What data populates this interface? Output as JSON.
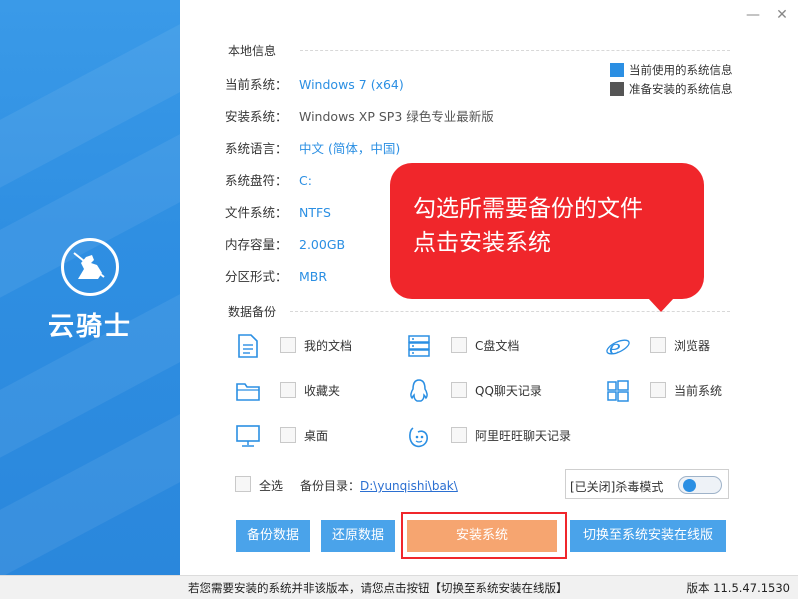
{
  "app": {
    "logo_text": "云骑士",
    "colors": {
      "accent": "#2b8fe3",
      "sidebar": "#2f8fe2",
      "tooltip": "#f0262b",
      "install": "#f6a570"
    }
  },
  "window": {
    "minimize": "—",
    "close": "✕"
  },
  "local_info": {
    "title": "本地信息",
    "rows": [
      {
        "label": "当前系统：",
        "value": "Windows 7 (x64)"
      },
      {
        "label": "安装系统：",
        "value": "Windows XP SP3 绿色专业最新版"
      },
      {
        "label": "系统语言：",
        "value": "中文 (简体，中国)"
      },
      {
        "label": "系统盘符：",
        "value": "C:"
      },
      {
        "label": "文件系统：",
        "value": "NTFS"
      },
      {
        "label": "内存容量：",
        "value": "2.00GB"
      },
      {
        "label": "分区形式：",
        "value": "MBR"
      }
    ],
    "legend": [
      {
        "label": "当前使用的系统信息",
        "color": "#2b8fe3"
      },
      {
        "label": "准备安装的系统信息",
        "color": "#555555"
      }
    ]
  },
  "tooltip": {
    "line1": "勾选所需要备份的文件",
    "line2": "点击安装系统"
  },
  "backup": {
    "title": "数据备份",
    "items": [
      {
        "label": "我的文档",
        "icon": "document-icon"
      },
      {
        "label": "C盘文档",
        "icon": "server-icon"
      },
      {
        "label": "浏览器",
        "icon": "ie-browser-icon"
      },
      {
        "label": "收藏夹",
        "icon": "folder-icon"
      },
      {
        "label": "QQ聊天记录",
        "icon": "qq-icon"
      },
      {
        "label": "当前系统",
        "icon": "windows-icon"
      },
      {
        "label": "桌面",
        "icon": "monitor-icon"
      },
      {
        "label": "阿里旺旺聊天记录",
        "icon": "wangwang-icon"
      }
    ],
    "select_all": "全选",
    "dir_label": "备份目录：",
    "dir_value": "D:\\yunqishi\\bak\\",
    "antivirus": "[已关闭]杀毒模式"
  },
  "buttons": {
    "backup": "备份数据",
    "restore": "还原数据",
    "install": "安装系统",
    "online": "切换至系统安装在线版"
  },
  "status": {
    "message": "若您需要安装的系统并非该版本，请您点击按钮【切换至系统安装在线版】",
    "version": "版本 11.5.47.1530"
  }
}
